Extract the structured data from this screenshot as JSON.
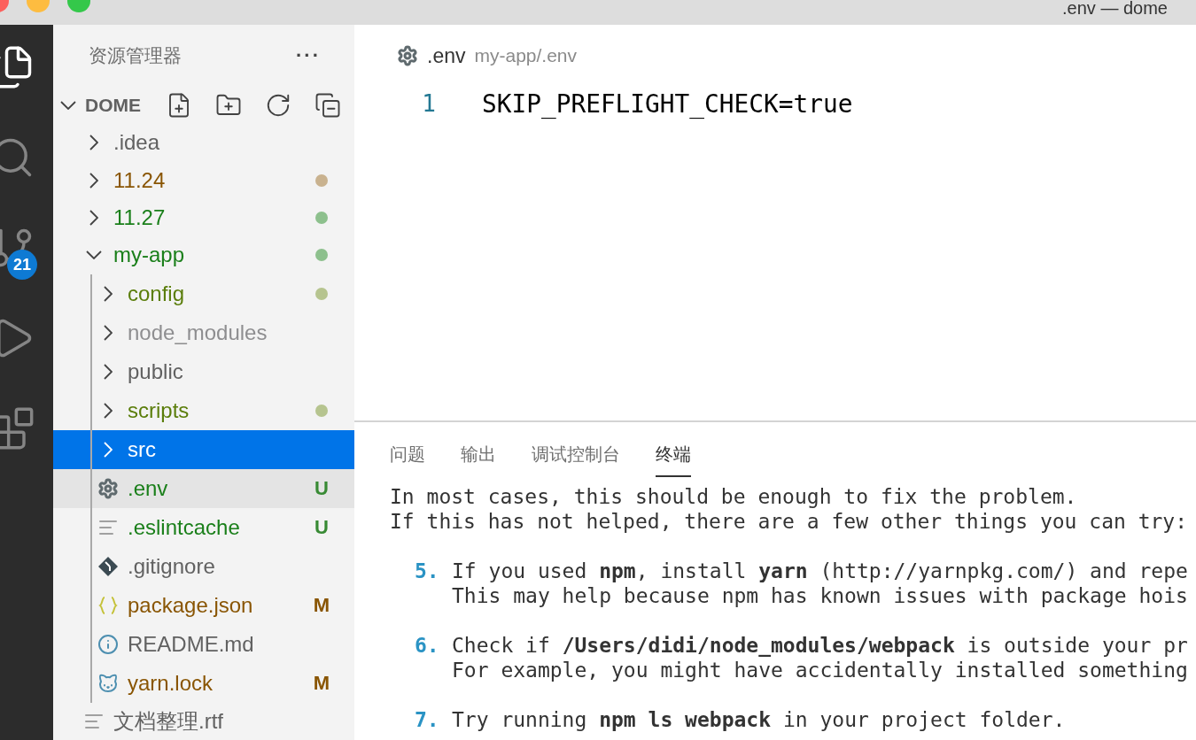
{
  "window": {
    "title": ".env — dome"
  },
  "activity_bar": {
    "items": [
      {
        "kind": "files",
        "selected": true
      },
      {
        "kind": "search",
        "selected": false
      },
      {
        "kind": "source-control",
        "selected": false,
        "badge": "21"
      },
      {
        "kind": "run",
        "selected": false
      },
      {
        "kind": "extensions",
        "selected": false
      }
    ]
  },
  "sidebar": {
    "title": "资源管理器",
    "more": "···",
    "folder": {
      "name": "DOME",
      "expanded": true
    },
    "items": [
      {
        "name": ".idea",
        "kind": "folder",
        "expanded": false,
        "selected": false,
        "highlighted": false,
        "color": "#616161"
      },
      {
        "name": "11.24",
        "kind": "folder",
        "expanded": false,
        "selected": false,
        "highlighted": false,
        "color": "#895503",
        "decoration": {
          "kind": "dot",
          "color": "#c9b28f"
        }
      },
      {
        "name": "11.27",
        "kind": "folder",
        "expanded": false,
        "selected": false,
        "highlighted": false,
        "color": "#1a7f1a",
        "decoration": {
          "kind": "dot",
          "color": "#8dc08d"
        }
      },
      {
        "name": "my-app",
        "kind": "folder",
        "expanded": true,
        "selected": false,
        "highlighted": false,
        "color": "#1a7f1a",
        "decoration": {
          "kind": "dot",
          "color": "#8dc08d"
        },
        "children": [
          {
            "name": "config",
            "kind": "folder",
            "expanded": false,
            "selected": false,
            "highlighted": false,
            "color": "#5a7d0a",
            "decoration": {
              "kind": "dot",
              "color": "#b6c48f"
            }
          },
          {
            "name": "node_modules",
            "kind": "folder",
            "expanded": false,
            "selected": false,
            "highlighted": false,
            "color": "#8e8e90"
          },
          {
            "name": "public",
            "kind": "folder",
            "expanded": false,
            "selected": false,
            "highlighted": false,
            "color": "#616161"
          },
          {
            "name": "scripts",
            "kind": "folder",
            "expanded": false,
            "selected": false,
            "highlighted": false,
            "color": "#5a7d0a",
            "decoration": {
              "kind": "dot",
              "color": "#b6c48f"
            }
          },
          {
            "name": "src",
            "kind": "folder",
            "expanded": false,
            "selected": true,
            "highlighted": false,
            "color": "#ffffff"
          },
          {
            "name": ".env",
            "kind": "settings",
            "selected": false,
            "highlighted": true,
            "color": "#1a7f1a",
            "decoration": {
              "kind": "letter",
              "text": "U",
              "color": "#388a34"
            }
          },
          {
            "name": ".eslintcache",
            "kind": "text",
            "selected": false,
            "highlighted": false,
            "color": "#1a7f1a",
            "decoration": {
              "kind": "letter",
              "text": "U",
              "color": "#388a34"
            }
          },
          {
            "name": ".gitignore",
            "kind": "git",
            "selected": false,
            "highlighted": false,
            "color": "#616161"
          },
          {
            "name": "package.json",
            "kind": "json",
            "selected": false,
            "highlighted": false,
            "color": "#895503",
            "decoration": {
              "kind": "letter",
              "text": "M",
              "color": "#895503"
            }
          },
          {
            "name": "README.md",
            "kind": "info",
            "selected": false,
            "highlighted": false,
            "color": "#616161"
          },
          {
            "name": "yarn.lock",
            "kind": "yarn",
            "selected": false,
            "highlighted": false,
            "color": "#895503",
            "decoration": {
              "kind": "letter",
              "text": "M",
              "color": "#895503"
            }
          }
        ]
      },
      {
        "name": "文档整理.rtf",
        "kind": "text",
        "selected": false,
        "highlighted": false,
        "color": "#616161"
      }
    ]
  },
  "editor": {
    "breadcrumb": {
      "file": ".env",
      "path": "my-app/.env"
    },
    "lines": [
      {
        "number": "1",
        "code": "SKIP_PREFLIGHT_CHECK=true"
      }
    ]
  },
  "panel": {
    "tabs": [
      {
        "label": "问题",
        "selected": false
      },
      {
        "label": "输出",
        "selected": false
      },
      {
        "label": "调试控制台",
        "selected": false
      },
      {
        "label": "终端",
        "selected": true
      }
    ],
    "terminal": [
      {
        "kind": "text",
        "text": "In most cases, this should be enough to fix the problem."
      },
      {
        "kind": "text",
        "text": "If this has not helped, there are a few other things you can try:"
      },
      {
        "kind": "blank"
      },
      {
        "kind": "item",
        "number": "5.",
        "lines": [
          "If you used **npm**, install **yarn** (http://yarnpkg.com/) and repe",
          "This may help because npm has known issues with package hois"
        ]
      },
      {
        "kind": "blank"
      },
      {
        "kind": "item",
        "number": "6.",
        "lines": [
          "Check if **/Users/didi/node_modules/webpack** is outside your pr",
          "For example, you might have accidentally installed something"
        ]
      },
      {
        "kind": "blank"
      },
      {
        "kind": "item",
        "number": "7.",
        "lines": [
          "Try running **npm ls webpack** in your project folder."
        ]
      }
    ]
  }
}
